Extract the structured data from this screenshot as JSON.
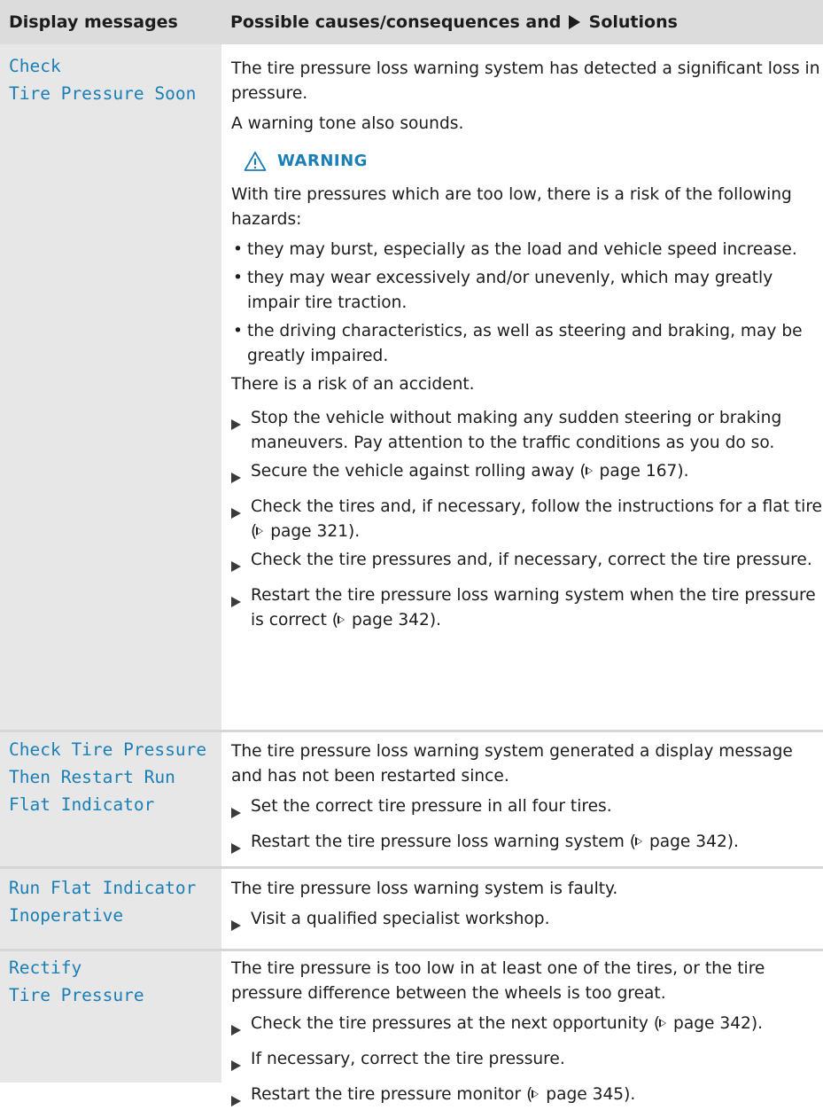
{
  "header": {
    "col1": "Display messages",
    "col2_before": "Possible causes/consequences and",
    "col2_after": "Solutions"
  },
  "rows": [
    {
      "message_line1": "Check",
      "message_line2": "Tire Pressure Soon",
      "p1": "The tire pressure loss warning system has detected a significant loss in pressure.",
      "p2": "A warning tone also sounds.",
      "warning_label": "WARNING",
      "warning_text": "With tire pressures which are too low, there is a risk of the following hazards:",
      "bullets": [
        "they may burst, especially as the load and vehicle speed increase.",
        "they may wear excessively and/or unevenly, which may greatly impair tire traction.",
        "the driving characteristics, as well as steering and braking, may be greatly impaired."
      ],
      "risk": "There is a risk of an accident.",
      "steps": [
        {
          "text": "Stop the vehicle without making any sudden steering or braking maneuvers. Pay attention to the traffic conditions as you do so.",
          "ref": ""
        },
        {
          "text": "Secure the vehicle against rolling away (",
          "ref": "page 167",
          "after": ")."
        },
        {
          "text": "Check the tires and, if necessary, follow the instructions for a flat tire (",
          "ref": "page 321",
          "after": ")."
        },
        {
          "text": "Check the tire pressures and, if necessary, correct the tire pressure.",
          "ref": ""
        },
        {
          "text": "Restart the tire pressure loss warning system when the tire pressure is correct (",
          "ref": "page 342",
          "after": ")."
        }
      ]
    },
    {
      "message_lines": [
        "Check Tire Pressure",
        "Then Restart Run",
        "Flat Indicator"
      ],
      "p1": "The tire pressure loss warning system generated a display message and has not been restarted since.",
      "steps": [
        {
          "text": "Set the correct tire pressure in all four tires.",
          "ref": ""
        },
        {
          "text": "Restart the tire pressure loss warning system (",
          "ref": "page 342",
          "after": ")."
        }
      ]
    },
    {
      "message_lines": [
        "Run Flat Indicator",
        "Inoperative"
      ],
      "p1": "The tire pressure loss warning system is faulty.",
      "steps": [
        {
          "text": "Visit a qualified specialist workshop.",
          "ref": ""
        }
      ]
    },
    {
      "message_lines": [
        "Rectify",
        "Tire Pressure"
      ],
      "p1": "The tire pressure is too low in at least one of the tires, or the tire pressure difference between the wheels is too great.",
      "steps": [
        {
          "text": "Check the tire pressures at the next opportunity (",
          "ref": "page 342",
          "after": ")."
        },
        {
          "text": "If necessary, correct the tire pressure.",
          "ref": ""
        },
        {
          "text": "Restart the tire pressure monitor (",
          "ref": "page 345",
          "after": ")."
        }
      ]
    }
  ],
  "colors": {
    "header_bg": "#dcdcdc",
    "left_col_bg": "#e7e7e7",
    "accent": "#1a7fb6",
    "text": "#1c1c1c"
  }
}
